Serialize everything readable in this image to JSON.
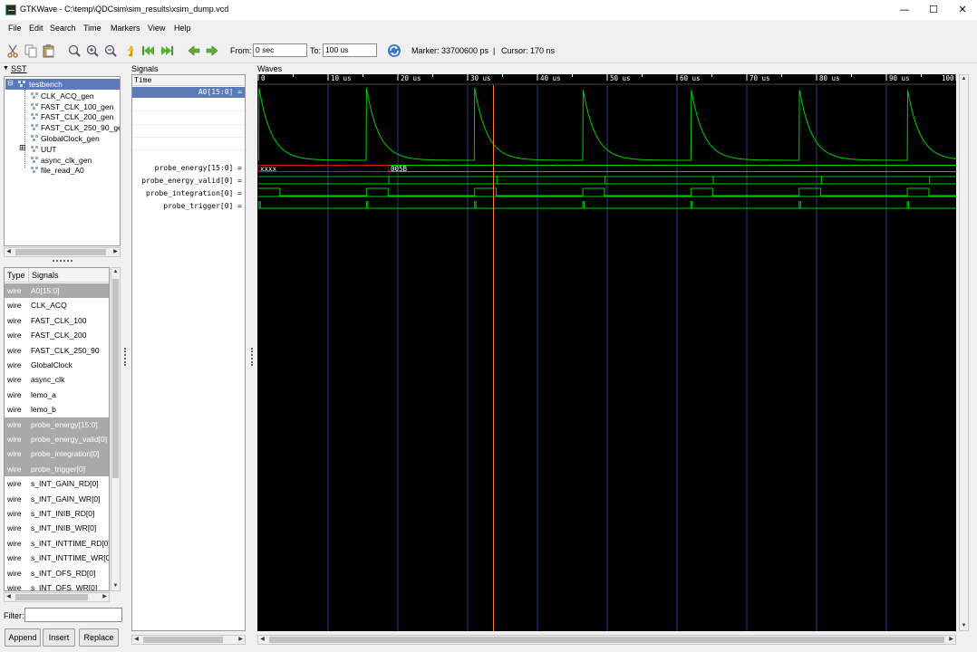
{
  "window": {
    "title": "GTKWave - C:\\temp\\QDCsim\\sim_results\\xsim_dump.vcd",
    "minimize": "—",
    "maximize": "☐",
    "close": "✕"
  },
  "menu": [
    "File",
    "Edit",
    "Search",
    "Time",
    "Markers",
    "View",
    "Help"
  ],
  "toolbar": {
    "from_label": "From:",
    "from_value": "0 sec",
    "to_label": "To:",
    "to_value": "100 us",
    "marker": "Marker: 33700600 ps",
    "separator": "|",
    "cursor": "Cursor: 170 ns"
  },
  "sst": {
    "header": "SST",
    "tree": [
      "testbench",
      "CLK_ACQ_gen",
      "FAST_CLK_100_gen",
      "FAST_CLK_200_gen",
      "FAST_CLK_250_90_gen",
      "GlobalClock_gen",
      "UUT",
      "async_clk_gen",
      "file_read_A0"
    ]
  },
  "signal_list": {
    "col_type": "Type",
    "col_signals": "Signals",
    "rows": [
      {
        "type": "wire",
        "name": "A0[15:0]",
        "selected": true
      },
      {
        "type": "wire",
        "name": "CLK_ACQ",
        "selected": false
      },
      {
        "type": "wire",
        "name": "FAST_CLK_100",
        "selected": false
      },
      {
        "type": "wire",
        "name": "FAST_CLK_200",
        "selected": false
      },
      {
        "type": "wire",
        "name": "FAST_CLK_250_90",
        "selected": false
      },
      {
        "type": "wire",
        "name": "GlobalClock",
        "selected": false
      },
      {
        "type": "wire",
        "name": "async_clk",
        "selected": false
      },
      {
        "type": "wire",
        "name": "lemo_a",
        "selected": false
      },
      {
        "type": "wire",
        "name": "lemo_b",
        "selected": false
      },
      {
        "type": "wire",
        "name": "probe_energy[15:0]",
        "selected": true
      },
      {
        "type": "wire",
        "name": "probe_energy_valid[0]",
        "selected": true
      },
      {
        "type": "wire",
        "name": "probe_integration[0]",
        "selected": true
      },
      {
        "type": "wire",
        "name": "probe_trigger[0]",
        "selected": true
      },
      {
        "type": "wire",
        "name": "s_INT_GAIN_RD[0]",
        "selected": false
      },
      {
        "type": "wire",
        "name": "s_INT_GAIN_WR[0]",
        "selected": false
      },
      {
        "type": "wire",
        "name": "s_INT_INIB_RD[0]",
        "selected": false
      },
      {
        "type": "wire",
        "name": "s_INT_INIB_WR[0]",
        "selected": false
      },
      {
        "type": "wire",
        "name": "s_INT_INTTIME_RD[0]",
        "selected": false
      },
      {
        "type": "wire",
        "name": "s_INT_INTTIME_WR[0]",
        "selected": false
      },
      {
        "type": "wire",
        "name": "s_INT_OFS_RD[0]",
        "selected": false
      },
      {
        "type": "wire",
        "name": "s_INT_OFS_WR[0]",
        "selected": false
      }
    ]
  },
  "filter": {
    "label": "Filter:",
    "value": ""
  },
  "buttons": {
    "append": "Append",
    "insert": "Insert",
    "replace": "Replace"
  },
  "signals_panel": {
    "header": "Signals",
    "time_label": "Time",
    "rows": [
      "A0[15:0] =",
      "probe_energy[15:0] =",
      "probe_energy_valid[0] =",
      "probe_integration[0] =",
      "probe_trigger[0] ="
    ]
  },
  "waves": {
    "header": "Waves",
    "time_range_us": [
      0,
      100
    ],
    "tick_labels": [
      "0",
      "10 us",
      "20 us",
      "30 us",
      "40 us",
      "50 us",
      "60 us",
      "70 us",
      "80 us",
      "90 us",
      "100"
    ],
    "marker_time_us": 33.7,
    "pulse_start_times_us": [
      0.1,
      15.5,
      31.0,
      46.5,
      62.0,
      77.5,
      93.0
    ],
    "probe_energy_values": [
      "xxxx",
      "005B"
    ],
    "probe_energy_change_us": 18.7,
    "colors": {
      "trace": "#00d000",
      "grid": "#2a3a8a",
      "marker": "#ff8040",
      "undefined": "#d01010"
    }
  }
}
